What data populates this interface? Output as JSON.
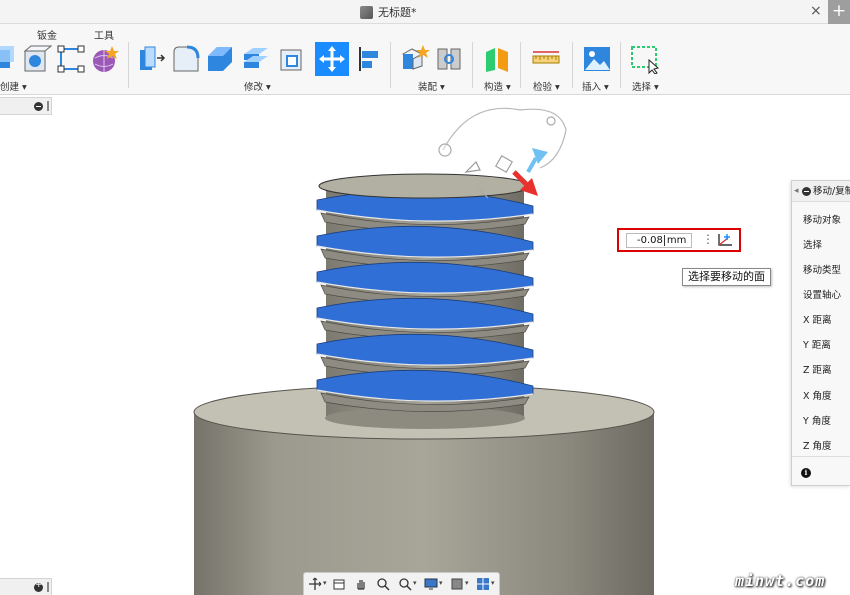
{
  "window": {
    "title": "无标题*",
    "close_glyph": "×",
    "new_tab_glyph": "+"
  },
  "ribbon": {
    "tabs": [
      {
        "label": "钣金"
      },
      {
        "label": "工具"
      }
    ],
    "groups": [
      {
        "label": "创建 ▾"
      },
      {
        "label": "修改 ▾"
      },
      {
        "label": "装配 ▾"
      },
      {
        "label": "构造 ▾"
      },
      {
        "label": "检验 ▾"
      },
      {
        "label": "插入 ▾"
      },
      {
        "label": "选择 ▾"
      }
    ],
    "icons": [
      "extrude-icon",
      "box-icon",
      "sketch-points-icon",
      "form-icon",
      "press-pull-icon",
      "fillet-icon",
      "chamfer-icon",
      "shell-icon",
      "scale-icon",
      "move-copy-icon",
      "align-icon",
      "new-component-icon",
      "joint-icon",
      "offset-plane-icon",
      "measure-icon",
      "insert-image-icon",
      "select-window-icon"
    ],
    "accent_color": "#1a8cff"
  },
  "move_input": {
    "value": "-0.08",
    "unit": "mm",
    "menu_glyph": "⋮"
  },
  "tooltip": {
    "text": "选择要移动的面"
  },
  "palette": {
    "title": "移动/复制",
    "rows": [
      "移动对象",
      "选择",
      "移动类型",
      "设置轴心",
      "X 距离",
      "Y 距离",
      "Z 距离",
      "X 角度",
      "Y 角度",
      "Z 角度"
    ],
    "info_glyph": "i"
  },
  "nav_icons": [
    "orbit-icon",
    "look-at-icon",
    "pan-icon",
    "zoom-icon",
    "zoom-window-icon",
    "display-settings-icon",
    "visual-style-icon",
    "grid-icon"
  ],
  "watermark": "minwt.com"
}
